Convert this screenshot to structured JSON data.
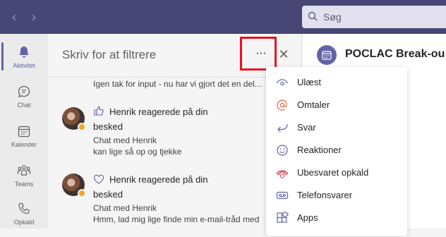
{
  "search": {
    "placeholder": "Søg"
  },
  "rail": {
    "items": [
      {
        "label": "Aktivitet"
      },
      {
        "label": "Chat"
      },
      {
        "label": "Kalender"
      },
      {
        "label": "Teams"
      },
      {
        "label": "Opkald"
      }
    ]
  },
  "panel": {
    "filter_placeholder": "Skriv for at filtrere",
    "more_label": "···",
    "close_label": "✕",
    "prev_item_text": "Igen tak for input - nu har vi gjort det en del...",
    "notifications": [
      {
        "title_line1": "Henrik reagerede på din",
        "title_line2": "besked",
        "context": "Chat med Henrik",
        "preview": "kan lige så op og tjekke"
      },
      {
        "title_line1": "Henrik reagerede på din",
        "title_line2": "besked",
        "context": "Chat med Henrik",
        "preview": "Hmm, lad mig lige finde min e-mail-tråd med"
      }
    ]
  },
  "right_pane": {
    "title": "POCLAC Break-ou"
  },
  "menu": {
    "items": [
      {
        "label": "Ulæst",
        "icon": "eye-icon",
        "color": "#6264a7"
      },
      {
        "label": "Omtaler",
        "icon": "at-icon",
        "color": "#e8603c"
      },
      {
        "label": "Svar",
        "icon": "reply-icon",
        "color": "#6264a7"
      },
      {
        "label": "Reaktioner",
        "icon": "smiley-icon",
        "color": "#6264a7"
      },
      {
        "label": "Ubesvaret opkald",
        "icon": "missed-call-icon",
        "color": "#c4314b"
      },
      {
        "label": "Telefonsvarer",
        "icon": "voicemail-icon",
        "color": "#6264a7"
      },
      {
        "label": "Apps",
        "icon": "apps-icon",
        "color": "#6264a7"
      }
    ]
  },
  "colors": {
    "topbar": "#464775",
    "accent": "#6264a7",
    "highlight": "#e81123"
  }
}
